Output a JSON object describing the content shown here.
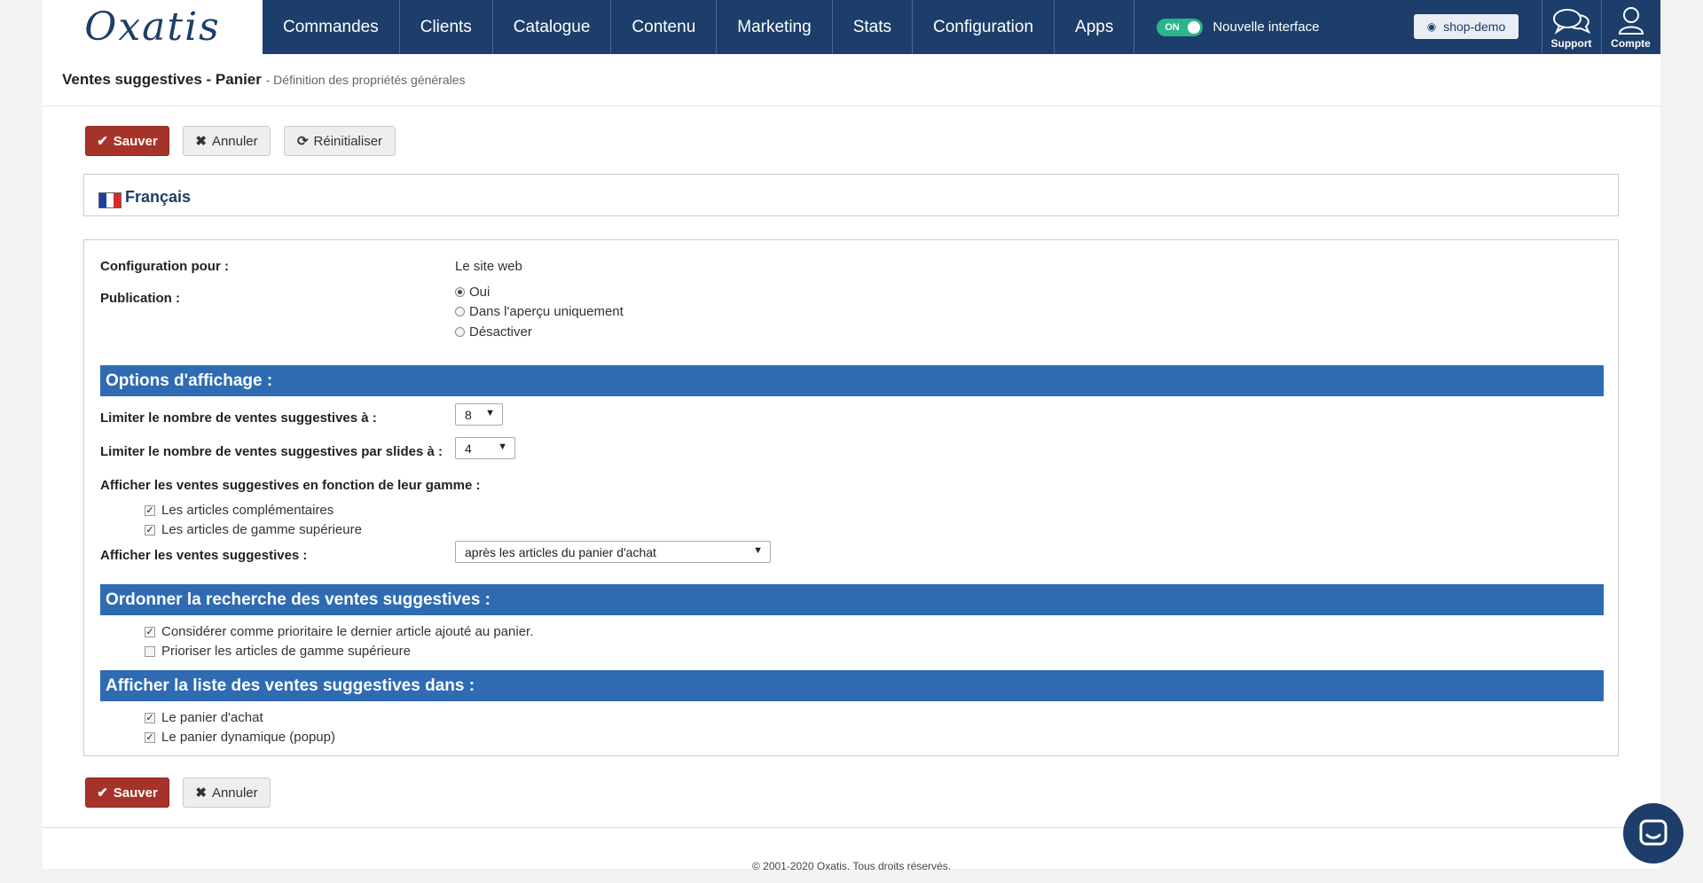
{
  "brand": {
    "logo": "Oxatis"
  },
  "nav": {
    "items": [
      "Commandes",
      "Clients",
      "Catalogue",
      "Contenu",
      "Marketing",
      "Stats",
      "Configuration",
      "Apps"
    ],
    "toggle_state": "ON",
    "toggle_label": "Nouvelle interface",
    "shop_button": "shop-demo",
    "support": "Support",
    "account": "Compte"
  },
  "header": {
    "title": "Ventes suggestives - Panier",
    "subtitle": "- Définition des propriétés générales"
  },
  "actions": {
    "save": "Sauver",
    "cancel": "Annuler",
    "reset": "Réinitialiser"
  },
  "language": {
    "label": "Français"
  },
  "config": {
    "config_for_label": "Configuration pour :",
    "config_for_value": "Le site web",
    "publication_label": "Publication :",
    "publication_options": [
      {
        "label": "Oui",
        "checked": true
      },
      {
        "label": "Dans l'aperçu uniquement",
        "checked": false
      },
      {
        "label": "Désactiver",
        "checked": false
      }
    ]
  },
  "display_options": {
    "title": "Options d'affichage :",
    "limit_label": "Limiter le nombre de ventes suggestives à :",
    "limit_value": "8",
    "limit_slides_label": "Limiter le nombre de ventes suggestives par slides à :",
    "limit_slides_value": "4",
    "range_label": "Afficher les ventes suggestives en fonction de leur gamme :",
    "range_options": [
      {
        "label": "Les articles complémentaires",
        "checked": true
      },
      {
        "label": "Les articles de gamme supérieure",
        "checked": true
      }
    ],
    "show_label": "Afficher les ventes suggestives :",
    "show_value": "après les articles du panier d'achat"
  },
  "ordering": {
    "title": "Ordonner la recherche des ventes suggestives :",
    "options": [
      {
        "label": "Considérer comme prioritaire le dernier article ajouté au panier.",
        "checked": true
      },
      {
        "label": "Prioriser les articles de gamme supérieure",
        "checked": false
      }
    ]
  },
  "display_in": {
    "title": "Afficher la liste des ventes suggestives dans :",
    "options": [
      {
        "label": "Le panier d'achat",
        "checked": true
      },
      {
        "label": "Le panier dynamique (popup)",
        "checked": true
      }
    ]
  },
  "footer": {
    "copyright": "© 2001-2020 Oxatis. Tous droits réservés."
  },
  "colors": {
    "nav_bg": "#1d3e6a",
    "section_bg": "#2e6bb3",
    "save_bg": "#a63329",
    "toggle_on": "#2bb58a"
  }
}
